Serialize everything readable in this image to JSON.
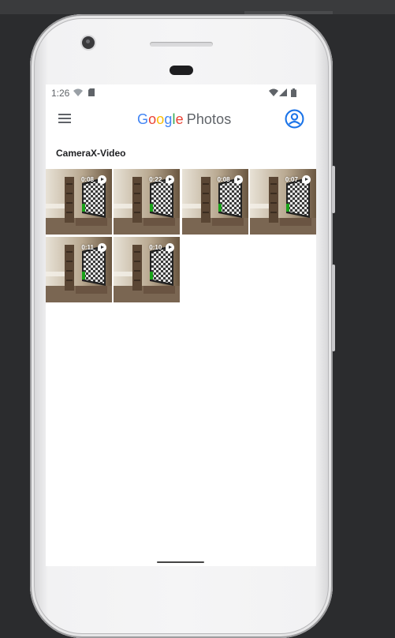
{
  "status_bar": {
    "time": "1:26",
    "icons": [
      "wifi-off-icon",
      "sim-card-icon",
      "wifi-icon",
      "signal-icon",
      "battery-icon"
    ]
  },
  "app_bar": {
    "logo_letters": [
      "G",
      "o",
      "o",
      "g",
      "l",
      "e"
    ],
    "logo_word": "Photos",
    "icons": [
      "menu-icon",
      "account-circle-icon"
    ]
  },
  "album": {
    "title": "CameraX-Video"
  },
  "videos": [
    {
      "duration": "0:08"
    },
    {
      "duration": "0:22"
    },
    {
      "duration": "0:08"
    },
    {
      "duration": "0:07"
    },
    {
      "duration": "0:11"
    },
    {
      "duration": "0:10"
    }
  ],
  "colors": {
    "accent": "#1a73e8",
    "frame_background": "#2b2c2e",
    "screen_background": "#ffffff"
  }
}
